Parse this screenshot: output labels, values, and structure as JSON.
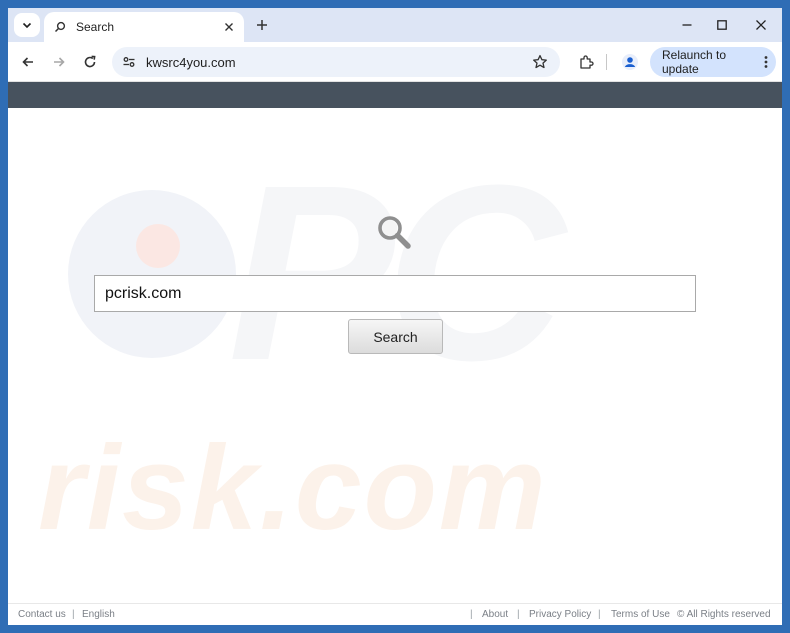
{
  "browser": {
    "tab": {
      "title": "Search"
    },
    "address": {
      "url": "kwsrc4you.com"
    },
    "relaunch_label": "Relaunch to update"
  },
  "page": {
    "watermark": {
      "top": "PC",
      "bottom": "risk.com"
    },
    "search": {
      "value": "pcrisk.com",
      "button_label": "Search"
    },
    "footer": {
      "contact": "Contact us",
      "language": "English",
      "about": "About",
      "privacy": "Privacy Policy",
      "terms": "Terms of Use",
      "rights": "© All Rights reserved",
      "separator": "|"
    }
  },
  "colors": {
    "frame": "#2f6db5",
    "tabstrip": "#dde5f5",
    "omnibox": "#edf2fa",
    "relaunch": "#d3e3fd",
    "page_bar": "#47525e"
  }
}
